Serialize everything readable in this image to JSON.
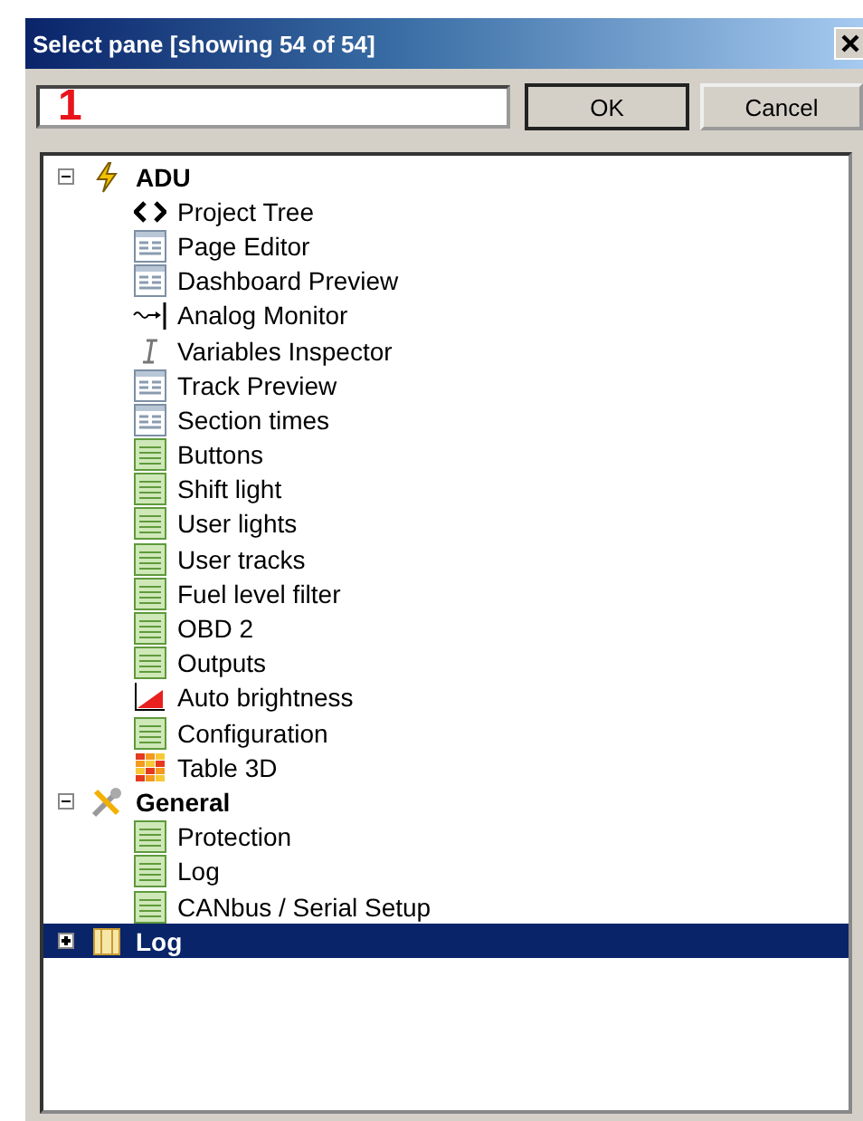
{
  "window": {
    "title": "Select pane [showing 54 of 54]"
  },
  "search": {
    "annotation": "1"
  },
  "buttons": [
    "OK",
    "Cancel"
  ],
  "tree": [
    {
      "label": "ADU",
      "kind": "bolt",
      "expanded": true,
      "selected": false,
      "children": [
        {
          "label": "Project Tree",
          "kind": "code"
        },
        {
          "label": "Page Editor",
          "kind": "form"
        },
        {
          "label": "Dashboard Preview",
          "kind": "form"
        },
        {
          "label": "Analog Monitor",
          "kind": "wave"
        },
        {
          "label": "Variables Inspector",
          "kind": "cursor"
        },
        {
          "label": "Track Preview",
          "kind": "form"
        },
        {
          "label": "Section times",
          "kind": "form"
        },
        {
          "label": "Buttons",
          "kind": "list"
        },
        {
          "label": "Shift light",
          "kind": "list"
        },
        {
          "label": "User lights",
          "kind": "list"
        },
        {
          "label": "User tracks",
          "kind": "list"
        },
        {
          "label": "Fuel level filter",
          "kind": "list"
        },
        {
          "label": "OBD 2",
          "kind": "list"
        },
        {
          "label": "Outputs",
          "kind": "list"
        },
        {
          "label": "Auto brightness",
          "kind": "chart"
        },
        {
          "label": "Configuration",
          "kind": "list"
        },
        {
          "label": "Table 3D",
          "kind": "grid"
        }
      ]
    },
    {
      "label": "General",
      "kind": "tools",
      "expanded": true,
      "selected": false,
      "children": [
        {
          "label": "Protection",
          "kind": "list"
        },
        {
          "label": "Log",
          "kind": "list"
        },
        {
          "label": "CANbus / Serial Setup",
          "kind": "list"
        }
      ]
    },
    {
      "label": "Log",
      "kind": "log",
      "expanded": false,
      "selected": true
    }
  ]
}
